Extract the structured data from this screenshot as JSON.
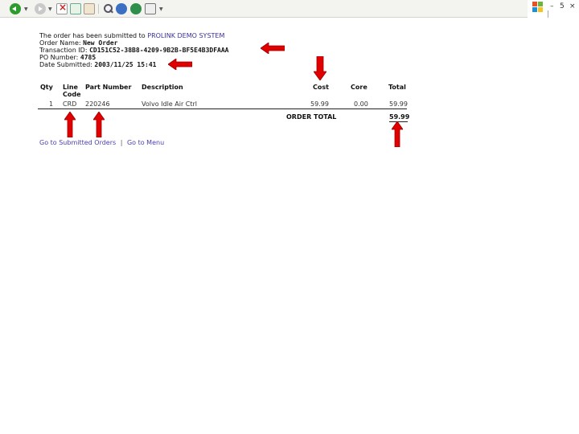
{
  "browser": {
    "window_controls": {
      "minimize": "–",
      "restore": "5",
      "close": "×"
    }
  },
  "confirmation": {
    "intro_text": "The order has been submitted to ",
    "system_name": "PROLINK DEMO SYSTEM",
    "order_name_label": "Order Name: ",
    "order_name_value": "New Order",
    "transaction_id_label": "Transaction ID: ",
    "transaction_id_value": "CD151C52-38B8-4209-9B2B-BF5E4B3DFAAA",
    "po_number_label": "PO Number: ",
    "po_number_value": "4785",
    "date_submitted_label": "Date Submitted: ",
    "date_submitted_value": "2003/11/25 15:41"
  },
  "table": {
    "headers": {
      "qty": "Qty",
      "line_code_1": "Line",
      "line_code_2": "Code",
      "part_number": "Part Number",
      "description": "Description",
      "cost": "Cost",
      "core": "Core",
      "total": "Total"
    },
    "rows": [
      {
        "qty": "1",
        "line_code": "CRD",
        "part_number": "220246",
        "description": "Volvo Idle Air Ctrl",
        "cost": "59.99",
        "core": "0.00",
        "total": "59.99"
      }
    ],
    "order_total_label": "ORDER TOTAL",
    "order_total_value": "59.99"
  },
  "links": {
    "submitted_orders": "Go to Submitted Orders",
    "separator": "|",
    "menu": "Go to Menu"
  },
  "annotation_color": "#e00000"
}
